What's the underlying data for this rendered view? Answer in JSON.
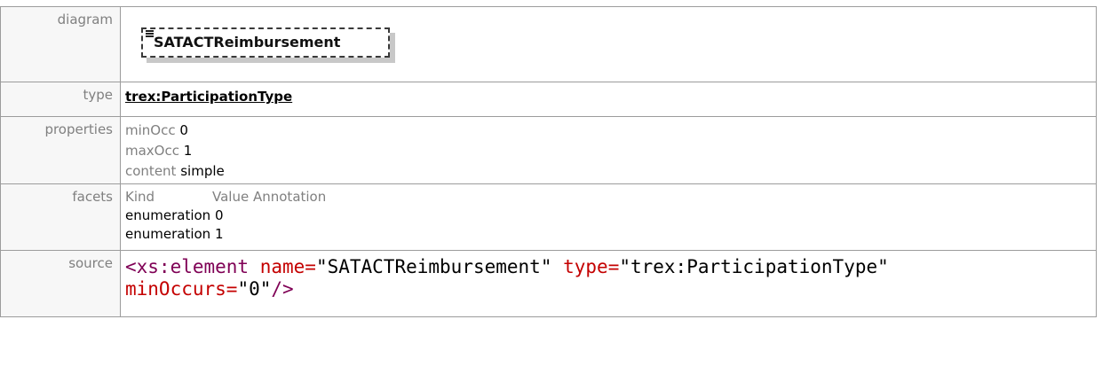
{
  "labels": {
    "diagram": "diagram",
    "type": "type",
    "properties": "properties",
    "facets": "facets",
    "source": "source"
  },
  "diagram": {
    "element_name": "SATACTReimbursement",
    "icon": "list-lines-icon"
  },
  "type": {
    "link_text": "trex:ParticipationType"
  },
  "properties": [
    {
      "key": "minOcc",
      "value": "0"
    },
    {
      "key": "maxOcc",
      "value": "1"
    },
    {
      "key": "content",
      "value": "simple"
    }
  ],
  "facets": {
    "headers": [
      "Kind",
      "Value",
      "Annotation"
    ],
    "rows": [
      {
        "kind": "enumeration",
        "value": "0"
      },
      {
        "kind": "enumeration",
        "value": "1"
      }
    ]
  },
  "source": {
    "open": "<xs:element",
    "name_attr": "name=",
    "name_val": "\"SATACTReimbursement\"",
    "type_attr": "type=",
    "type_val": "\"trex:ParticipationType\"",
    "min_attr": "minOccurs=",
    "min_val": "\"0\"",
    "close": "/>"
  },
  "colors": {
    "border": "#9c9c9c",
    "label_bg": "#f7f7f7",
    "label_text": "#808080",
    "xml_tag": "#7f0055",
    "xml_attr": "#c40000",
    "xml_string": "#2a00ff"
  }
}
